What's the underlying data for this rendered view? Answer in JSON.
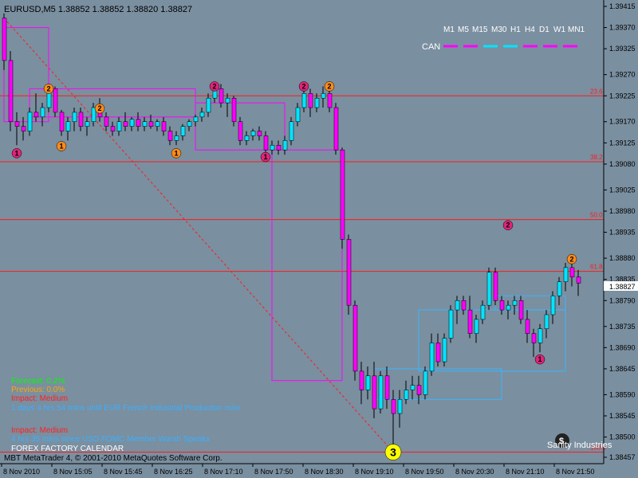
{
  "colors": {
    "background": "#7a8fa0",
    "bull": "#00e5ff",
    "bear": "#ff00ff",
    "fib_line": "#ff1a1a",
    "box": "#ff00ff",
    "box2": "#39b6ff",
    "wick": "#000000",
    "marker_magenta": "#e0247a",
    "marker_orange": "#ff8c1a",
    "marker_yellow": "#ffff00",
    "current_price_bg": "#ffffff"
  },
  "header": {
    "symbol_info": "EURUSD,M5  1.38852 1.38852 1.38820 1.38827"
  },
  "timeframes": [
    "M1",
    "M5",
    "M15",
    "M30",
    "H1",
    "H4",
    "D1",
    "W1",
    "MN1"
  ],
  "can_label": "CAN",
  "price_axis": {
    "min": 1.38457,
    "max": 1.39415,
    "ticks": [
      "1.39415",
      "1.39370",
      "1.39325",
      "1.39270",
      "1.39225",
      "1.39170",
      "1.39125",
      "1.39080",
      "1.39025",
      "1.38980",
      "1.38935",
      "1.38880",
      "1.38835",
      "1.38790",
      "1.38735",
      "1.38690",
      "1.38645",
      "1.38590",
      "1.38545",
      "1.38500",
      "1.38457"
    ],
    "current_price": "1.38827"
  },
  "time_axis": {
    "labels": [
      "8 Nov 2010",
      "8 Nov 15:05",
      "8 Nov 15:45",
      "8 Nov 16:25",
      "8 Nov 17:10",
      "8 Nov 17:50",
      "8 Nov 18:30",
      "8 Nov 19:10",
      "8 Nov 19:50",
      "8 Nov 20:30",
      "8 Nov 21:10",
      "8 Nov 21:50"
    ]
  },
  "fib_levels": [
    {
      "label": "23.6",
      "price": 1.39225
    },
    {
      "label": "38.2",
      "price": 1.39085
    },
    {
      "label": "50.0",
      "price": 1.38962
    },
    {
      "label": "61.8",
      "price": 1.38852
    },
    {
      "label": "100.0",
      "price": 1.38468
    }
  ],
  "info_panel": {
    "forecast": "Forecast: 0.2%",
    "previous": "Previous: 0.0%",
    "impact1": "Impact: Medium",
    "event1": "1 days 4 hrs 54 mins until EUR  French Industrial Production m/m",
    "impact2": "Impact: Medium",
    "event2": "4 hrs 35 mins since USD  FOMC Member Warsh Speaks",
    "calendar": "FOREX FACTORY CALENDAR"
  },
  "footer": "MBT MetaTrader 4, © 2001-2010 MetaQuotes Software Corp.",
  "logo": "Sanity Industries",
  "markers": [
    {
      "text": "1",
      "bar": 2,
      "price": 1.39103,
      "color": "magenta"
    },
    {
      "text": "2",
      "bar": 7,
      "price": 1.3924,
      "color": "orange"
    },
    {
      "text": "1",
      "bar": 9,
      "price": 1.39118,
      "color": "orange"
    },
    {
      "text": "2",
      "bar": 15,
      "price": 1.39198,
      "color": "orange"
    },
    {
      "text": "1",
      "bar": 27,
      "price": 1.39103,
      "color": "orange"
    },
    {
      "text": "2",
      "bar": 33,
      "price": 1.39245,
      "color": "magenta"
    },
    {
      "text": "1",
      "bar": 41,
      "price": 1.39095,
      "color": "magenta"
    },
    {
      "text": "2",
      "bar": 47,
      "price": 1.39245,
      "color": "magenta"
    },
    {
      "text": "2",
      "bar": 51,
      "price": 1.39245,
      "color": "orange"
    },
    {
      "text": "3",
      "bar": 61,
      "price": 1.38468,
      "color": "yellow"
    },
    {
      "text": "2",
      "bar": 79,
      "price": 1.3895,
      "color": "magenta"
    },
    {
      "text": "1",
      "bar": 84,
      "price": 1.38665,
      "color": "magenta"
    },
    {
      "text": "2",
      "bar": 89,
      "price": 1.38878,
      "color": "orange"
    }
  ],
  "candles": [
    [
      1.3939,
      1.394,
      1.3928,
      1.393
    ],
    [
      1.393,
      1.3932,
      1.3915,
      1.3917
    ],
    [
      1.3917,
      1.3919,
      1.3912,
      1.3916
    ],
    [
      1.3916,
      1.3918,
      1.3913,
      1.3915
    ],
    [
      1.3915,
      1.392,
      1.3914,
      1.3919
    ],
    [
      1.3919,
      1.3923,
      1.3917,
      1.3918
    ],
    [
      1.3918,
      1.3921,
      1.3916,
      1.392
    ],
    [
      1.392,
      1.3925,
      1.3919,
      1.3924
    ],
    [
      1.3924,
      1.39245,
      1.3918,
      1.3919
    ],
    [
      1.3919,
      1.39195,
      1.3914,
      1.3915
    ],
    [
      1.3915,
      1.3918,
      1.3913,
      1.3917
    ],
    [
      1.3917,
      1.392,
      1.3915,
      1.3919
    ],
    [
      1.3919,
      1.392,
      1.3915,
      1.3916
    ],
    [
      1.3916,
      1.3918,
      1.3914,
      1.3917
    ],
    [
      1.3917,
      1.3921,
      1.3916,
      1.392
    ],
    [
      1.392,
      1.3922,
      1.3917,
      1.3918
    ],
    [
      1.3918,
      1.3919,
      1.3915,
      1.3916
    ],
    [
      1.3916,
      1.3917,
      1.3914,
      1.3915
    ],
    [
      1.3915,
      1.3918,
      1.3914,
      1.3917
    ],
    [
      1.3917,
      1.3919,
      1.3915,
      1.3916
    ],
    [
      1.3916,
      1.3918,
      1.3915,
      1.39175
    ],
    [
      1.39175,
      1.3919,
      1.3915,
      1.3916
    ],
    [
      1.3916,
      1.3918,
      1.3915,
      1.3917
    ],
    [
      1.3917,
      1.39185,
      1.39155,
      1.3916
    ],
    [
      1.3916,
      1.39175,
      1.3915,
      1.3917
    ],
    [
      1.3917,
      1.3918,
      1.3914,
      1.3915
    ],
    [
      1.3915,
      1.3916,
      1.3912,
      1.3913
    ],
    [
      1.3913,
      1.3915,
      1.3912,
      1.3914
    ],
    [
      1.3914,
      1.39165,
      1.3913,
      1.3916
    ],
    [
      1.3916,
      1.39175,
      1.3915,
      1.3917
    ],
    [
      1.3917,
      1.39185,
      1.3916,
      1.3918
    ],
    [
      1.3918,
      1.392,
      1.3917,
      1.3919
    ],
    [
      1.3919,
      1.3923,
      1.3918,
      1.3922
    ],
    [
      1.3922,
      1.3925,
      1.3921,
      1.3924
    ],
    [
      1.3924,
      1.3925,
      1.392,
      1.3921
    ],
    [
      1.3921,
      1.3923,
      1.3918,
      1.3922
    ],
    [
      1.3922,
      1.39225,
      1.3916,
      1.3917
    ],
    [
      1.3917,
      1.3918,
      1.3912,
      1.3913
    ],
    [
      1.3913,
      1.3915,
      1.3912,
      1.3914
    ],
    [
      1.3914,
      1.39155,
      1.3913,
      1.3915
    ],
    [
      1.3915,
      1.3916,
      1.3913,
      1.3914
    ],
    [
      1.3914,
      1.3915,
      1.391,
      1.3911
    ],
    [
      1.3911,
      1.3913,
      1.391,
      1.3912
    ],
    [
      1.3912,
      1.3913,
      1.391,
      1.3911
    ],
    [
      1.3911,
      1.3914,
      1.391,
      1.3913
    ],
    [
      1.3913,
      1.3918,
      1.3912,
      1.3917
    ],
    [
      1.3917,
      1.3921,
      1.3916,
      1.392
    ],
    [
      1.392,
      1.3924,
      1.3919,
      1.3923
    ],
    [
      1.3923,
      1.3924,
      1.3918,
      1.392
    ],
    [
      1.392,
      1.3923,
      1.3919,
      1.3922
    ],
    [
      1.3922,
      1.39245,
      1.392,
      1.3923
    ],
    [
      1.3923,
      1.3924,
      1.3919,
      1.392
    ],
    [
      1.392,
      1.3921,
      1.391,
      1.3911
    ],
    [
      1.3911,
      1.39115,
      1.389,
      1.3892
    ],
    [
      1.3892,
      1.3893,
      1.3876,
      1.3878
    ],
    [
      1.3878,
      1.3879,
      1.3862,
      1.3864
    ],
    [
      1.3864,
      1.3866,
      1.3857,
      1.386
    ],
    [
      1.386,
      1.3865,
      1.3858,
      1.3863
    ],
    [
      1.3863,
      1.3866,
      1.3854,
      1.3856
    ],
    [
      1.3856,
      1.3864,
      1.3855,
      1.3863
    ],
    [
      1.3863,
      1.3865,
      1.3856,
      1.3858
    ],
    [
      1.3858,
      1.386,
      1.3847,
      1.3855
    ],
    [
      1.3855,
      1.386,
      1.3852,
      1.3858
    ],
    [
      1.3858,
      1.3862,
      1.3857,
      1.386
    ],
    [
      1.386,
      1.3863,
      1.3858,
      1.3861
    ],
    [
      1.3861,
      1.3863,
      1.3857,
      1.3859
    ],
    [
      1.3859,
      1.3865,
      1.3858,
      1.3864
    ],
    [
      1.3864,
      1.3872,
      1.3863,
      1.387
    ],
    [
      1.387,
      1.3872,
      1.3865,
      1.3866
    ],
    [
      1.3866,
      1.3872,
      1.3865,
      1.3871
    ],
    [
      1.3871,
      1.3878,
      1.387,
      1.3877
    ],
    [
      1.3877,
      1.388,
      1.3874,
      1.3879
    ],
    [
      1.3879,
      1.388,
      1.3876,
      1.3877
    ],
    [
      1.3877,
      1.388,
      1.3871,
      1.3872
    ],
    [
      1.3872,
      1.3876,
      1.387,
      1.3875
    ],
    [
      1.3875,
      1.3879,
      1.3874,
      1.3878
    ],
    [
      1.3878,
      1.3886,
      1.3877,
      1.3885
    ],
    [
      1.3885,
      1.3886,
      1.3878,
      1.3879
    ],
    [
      1.3879,
      1.388,
      1.3876,
      1.3877
    ],
    [
      1.3877,
      1.3879,
      1.3875,
      1.3878
    ],
    [
      1.3878,
      1.388,
      1.3876,
      1.3879
    ],
    [
      1.3879,
      1.388,
      1.3874,
      1.3875
    ],
    [
      1.3875,
      1.3877,
      1.387,
      1.3872
    ],
    [
      1.3872,
      1.3873,
      1.3867,
      1.387
    ],
    [
      1.387,
      1.3874,
      1.3868,
      1.3873
    ],
    [
      1.3873,
      1.3877,
      1.3871,
      1.3876
    ],
    [
      1.3876,
      1.3881,
      1.3874,
      1.388
    ],
    [
      1.388,
      1.3884,
      1.3878,
      1.3883
    ],
    [
      1.3883,
      1.3887,
      1.3881,
      1.3886
    ],
    [
      1.3886,
      1.38875,
      1.3882,
      1.3884
    ],
    [
      1.3884,
      1.38855,
      1.388,
      1.38827
    ]
  ]
}
